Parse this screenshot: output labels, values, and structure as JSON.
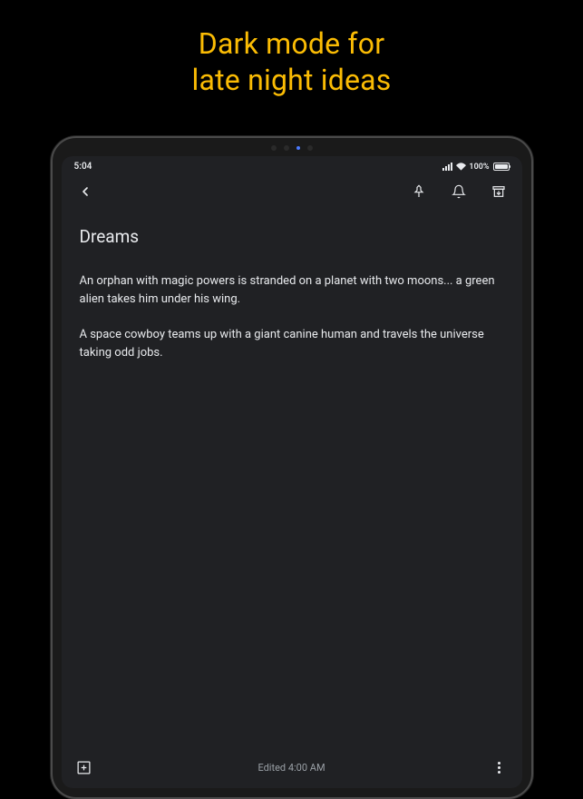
{
  "promo": {
    "line1": "Dark mode for",
    "line2": "late night ideas"
  },
  "statusBar": {
    "time": "5:04",
    "batteryPercent": "100%"
  },
  "note": {
    "title": "Dreams",
    "paragraph1": "An orphan with magic powers is stranded on a planet with two moons... a green alien takes him under his wing.",
    "paragraph2": "A space cowboy teams up with a giant canine human and travels the universe taking odd jobs."
  },
  "bottomBar": {
    "editedText": "Edited 4:00 AM"
  }
}
